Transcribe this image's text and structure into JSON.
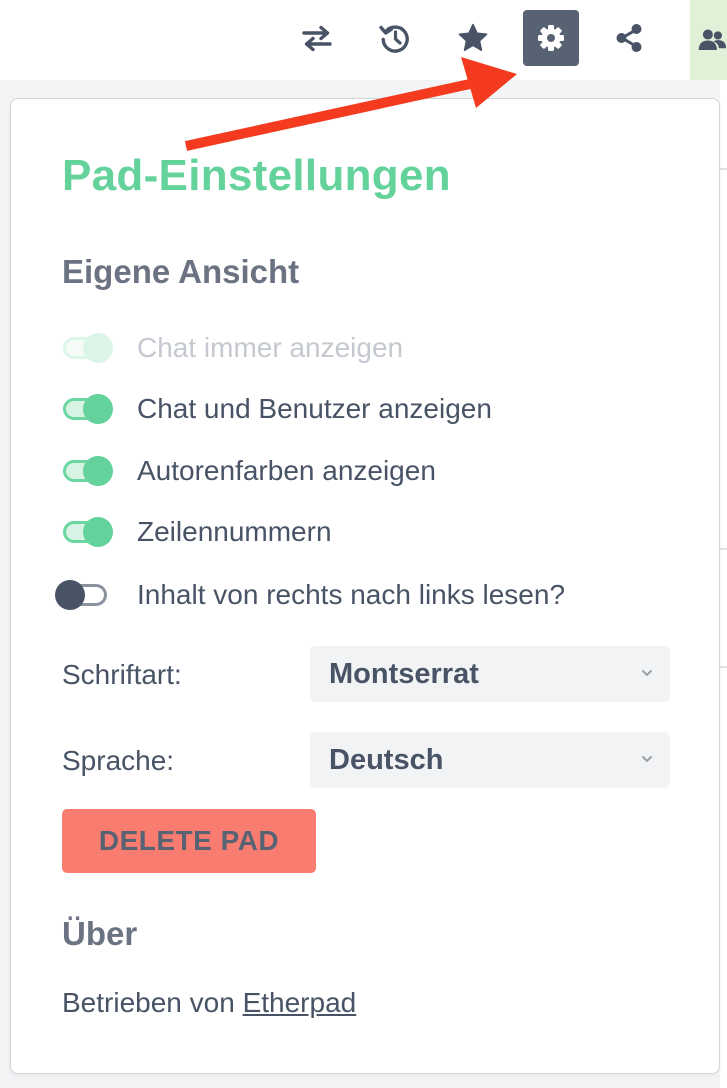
{
  "toolbar": {
    "buttons": [
      {
        "name": "import-export",
        "icon": "arrows-exchange-icon",
        "active": false
      },
      {
        "name": "timeslider",
        "icon": "history-icon",
        "active": false
      },
      {
        "name": "saved-revision",
        "icon": "star-icon",
        "active": false
      },
      {
        "name": "settings",
        "icon": "gear-icon",
        "active": true
      },
      {
        "name": "share",
        "icon": "share-icon",
        "active": false
      },
      {
        "name": "users",
        "icon": "users-icon",
        "active": false
      }
    ]
  },
  "annotation": {
    "arrow_color": "#f43a1f",
    "points_to": "settings-button"
  },
  "settings": {
    "title": "Pad-Einstellungen",
    "my_view_heading": "Eigene Ansicht",
    "options": [
      {
        "label": "Chat immer anzeigen",
        "checked": true,
        "disabled": true
      },
      {
        "label": "Chat und Benutzer anzeigen",
        "checked": true,
        "disabled": false
      },
      {
        "label": "Autorenfarben anzeigen",
        "checked": true,
        "disabled": false
      },
      {
        "label": "Zeilennummern",
        "checked": true,
        "disabled": false
      },
      {
        "label": "Inhalt von rechts nach links lesen?",
        "checked": false,
        "disabled": false
      }
    ],
    "font_label": "Schriftart:",
    "font_value": "Montserrat",
    "language_label": "Sprache:",
    "language_value": "Deutsch",
    "delete_label": "DELETE PAD",
    "about_heading": "Über",
    "powered_text": "Betrieben von",
    "powered_link": "Etherpad"
  },
  "colors": {
    "accent": "#64d29b",
    "danger": "#f97c71",
    "text": "#485365",
    "active_button": "#576273"
  }
}
